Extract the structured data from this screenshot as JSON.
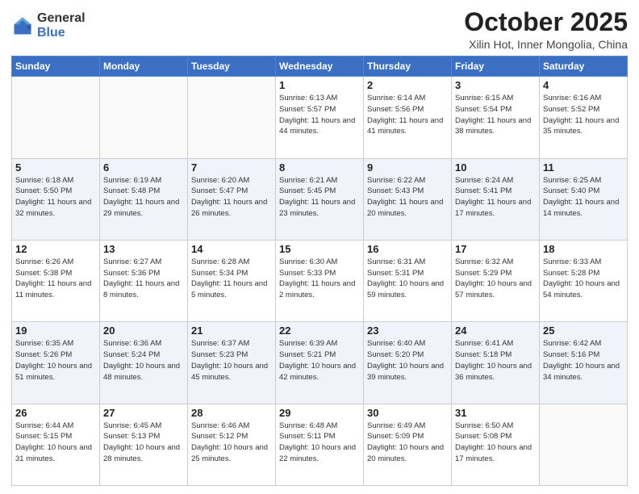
{
  "logo": {
    "general": "General",
    "blue": "Blue"
  },
  "header": {
    "month": "October 2025",
    "subtitle": "Xilin Hot, Inner Mongolia, China"
  },
  "weekdays": [
    "Sunday",
    "Monday",
    "Tuesday",
    "Wednesday",
    "Thursday",
    "Friday",
    "Saturday"
  ],
  "weeks": [
    [
      {
        "day": "",
        "info": ""
      },
      {
        "day": "",
        "info": ""
      },
      {
        "day": "",
        "info": ""
      },
      {
        "day": "1",
        "info": "Sunrise: 6:13 AM\nSunset: 5:57 PM\nDaylight: 11 hours and 44 minutes."
      },
      {
        "day": "2",
        "info": "Sunrise: 6:14 AM\nSunset: 5:56 PM\nDaylight: 11 hours and 41 minutes."
      },
      {
        "day": "3",
        "info": "Sunrise: 6:15 AM\nSunset: 5:54 PM\nDaylight: 11 hours and 38 minutes."
      },
      {
        "day": "4",
        "info": "Sunrise: 6:16 AM\nSunset: 5:52 PM\nDaylight: 11 hours and 35 minutes."
      }
    ],
    [
      {
        "day": "5",
        "info": "Sunrise: 6:18 AM\nSunset: 5:50 PM\nDaylight: 11 hours and 32 minutes."
      },
      {
        "day": "6",
        "info": "Sunrise: 6:19 AM\nSunset: 5:48 PM\nDaylight: 11 hours and 29 minutes."
      },
      {
        "day": "7",
        "info": "Sunrise: 6:20 AM\nSunset: 5:47 PM\nDaylight: 11 hours and 26 minutes."
      },
      {
        "day": "8",
        "info": "Sunrise: 6:21 AM\nSunset: 5:45 PM\nDaylight: 11 hours and 23 minutes."
      },
      {
        "day": "9",
        "info": "Sunrise: 6:22 AM\nSunset: 5:43 PM\nDaylight: 11 hours and 20 minutes."
      },
      {
        "day": "10",
        "info": "Sunrise: 6:24 AM\nSunset: 5:41 PM\nDaylight: 11 hours and 17 minutes."
      },
      {
        "day": "11",
        "info": "Sunrise: 6:25 AM\nSunset: 5:40 PM\nDaylight: 11 hours and 14 minutes."
      }
    ],
    [
      {
        "day": "12",
        "info": "Sunrise: 6:26 AM\nSunset: 5:38 PM\nDaylight: 11 hours and 11 minutes."
      },
      {
        "day": "13",
        "info": "Sunrise: 6:27 AM\nSunset: 5:36 PM\nDaylight: 11 hours and 8 minutes."
      },
      {
        "day": "14",
        "info": "Sunrise: 6:28 AM\nSunset: 5:34 PM\nDaylight: 11 hours and 5 minutes."
      },
      {
        "day": "15",
        "info": "Sunrise: 6:30 AM\nSunset: 5:33 PM\nDaylight: 11 hours and 2 minutes."
      },
      {
        "day": "16",
        "info": "Sunrise: 6:31 AM\nSunset: 5:31 PM\nDaylight: 10 hours and 59 minutes."
      },
      {
        "day": "17",
        "info": "Sunrise: 6:32 AM\nSunset: 5:29 PM\nDaylight: 10 hours and 57 minutes."
      },
      {
        "day": "18",
        "info": "Sunrise: 6:33 AM\nSunset: 5:28 PM\nDaylight: 10 hours and 54 minutes."
      }
    ],
    [
      {
        "day": "19",
        "info": "Sunrise: 6:35 AM\nSunset: 5:26 PM\nDaylight: 10 hours and 51 minutes."
      },
      {
        "day": "20",
        "info": "Sunrise: 6:36 AM\nSunset: 5:24 PM\nDaylight: 10 hours and 48 minutes."
      },
      {
        "day": "21",
        "info": "Sunrise: 6:37 AM\nSunset: 5:23 PM\nDaylight: 10 hours and 45 minutes."
      },
      {
        "day": "22",
        "info": "Sunrise: 6:39 AM\nSunset: 5:21 PM\nDaylight: 10 hours and 42 minutes."
      },
      {
        "day": "23",
        "info": "Sunrise: 6:40 AM\nSunset: 5:20 PM\nDaylight: 10 hours and 39 minutes."
      },
      {
        "day": "24",
        "info": "Sunrise: 6:41 AM\nSunset: 5:18 PM\nDaylight: 10 hours and 36 minutes."
      },
      {
        "day": "25",
        "info": "Sunrise: 6:42 AM\nSunset: 5:16 PM\nDaylight: 10 hours and 34 minutes."
      }
    ],
    [
      {
        "day": "26",
        "info": "Sunrise: 6:44 AM\nSunset: 5:15 PM\nDaylight: 10 hours and 31 minutes."
      },
      {
        "day": "27",
        "info": "Sunrise: 6:45 AM\nSunset: 5:13 PM\nDaylight: 10 hours and 28 minutes."
      },
      {
        "day": "28",
        "info": "Sunrise: 6:46 AM\nSunset: 5:12 PM\nDaylight: 10 hours and 25 minutes."
      },
      {
        "day": "29",
        "info": "Sunrise: 6:48 AM\nSunset: 5:11 PM\nDaylight: 10 hours and 22 minutes."
      },
      {
        "day": "30",
        "info": "Sunrise: 6:49 AM\nSunset: 5:09 PM\nDaylight: 10 hours and 20 minutes."
      },
      {
        "day": "31",
        "info": "Sunrise: 6:50 AM\nSunset: 5:08 PM\nDaylight: 10 hours and 17 minutes."
      },
      {
        "day": "",
        "info": ""
      }
    ]
  ]
}
